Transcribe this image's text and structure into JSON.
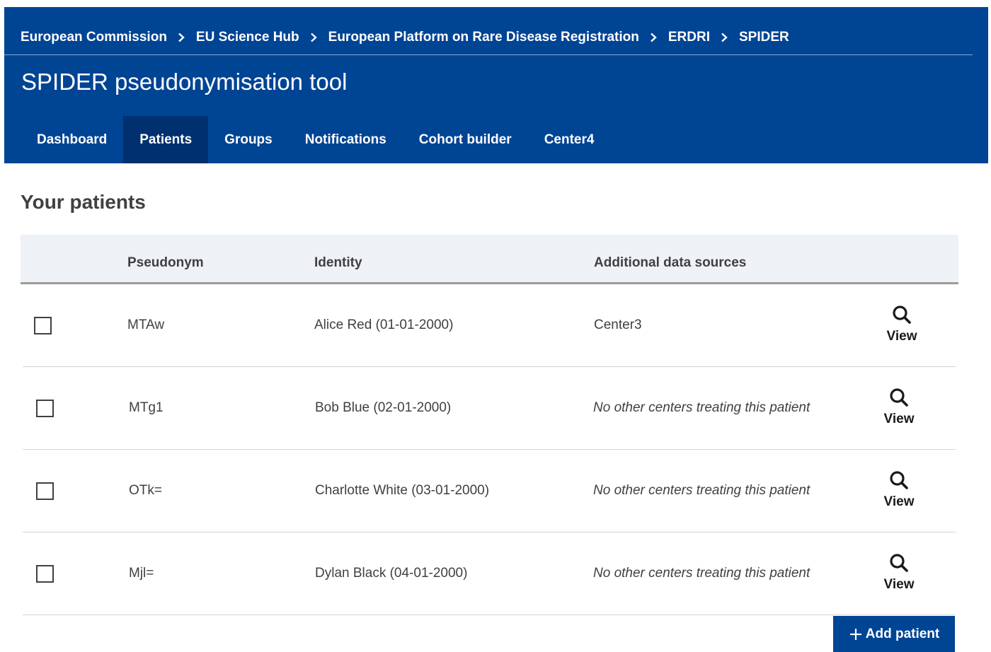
{
  "breadcrumb": [
    {
      "label": "European Commission"
    },
    {
      "label": "EU Science Hub"
    },
    {
      "label": "European Platform on Rare Disease Registration"
    },
    {
      "label": "ERDRI"
    },
    {
      "label": "SPIDER"
    }
  ],
  "app": {
    "title": "SPIDER pseudonymisation tool"
  },
  "nav": {
    "items": [
      {
        "label": "Dashboard"
      },
      {
        "label": "Patients",
        "active": true
      },
      {
        "label": "Groups"
      },
      {
        "label": "Notifications"
      },
      {
        "label": "Cohort builder"
      },
      {
        "label": "Center4"
      }
    ]
  },
  "section": {
    "title": "Your patients"
  },
  "table": {
    "columns": {
      "pseudonym": "Pseudonym",
      "identity": "Identity",
      "sources": "Additional data sources"
    },
    "rows": [
      {
        "pseudonym": "MTAw",
        "identity": "Alice Red (01-01-2000)",
        "sources": "Center3",
        "sources_italic": false,
        "view_label": "View"
      },
      {
        "pseudonym": "MTg1",
        "identity": "Bob Blue (02-01-2000)",
        "sources": "No other centers treating this patient",
        "sources_italic": true,
        "view_label": "View"
      },
      {
        "pseudonym": "OTk=",
        "identity": "Charlotte White (03-01-2000)",
        "sources": "No other centers treating this patient",
        "sources_italic": true,
        "view_label": "View"
      },
      {
        "pseudonym": "Mjl=",
        "identity": "Dylan Black (04-01-2000)",
        "sources": "No other centers treating this patient",
        "sources_italic": true,
        "view_label": "View"
      }
    ]
  },
  "actions": {
    "add_patient_label": "Add patient"
  },
  "colors": {
    "brand": "#004494",
    "nav_active": "#00306f",
    "table_header_bg": "#eef1f6",
    "text": "#404040"
  },
  "icons": {
    "breadcrumb_separator": "chevron-right-icon",
    "view": "search-icon",
    "add": "plus-icon"
  }
}
